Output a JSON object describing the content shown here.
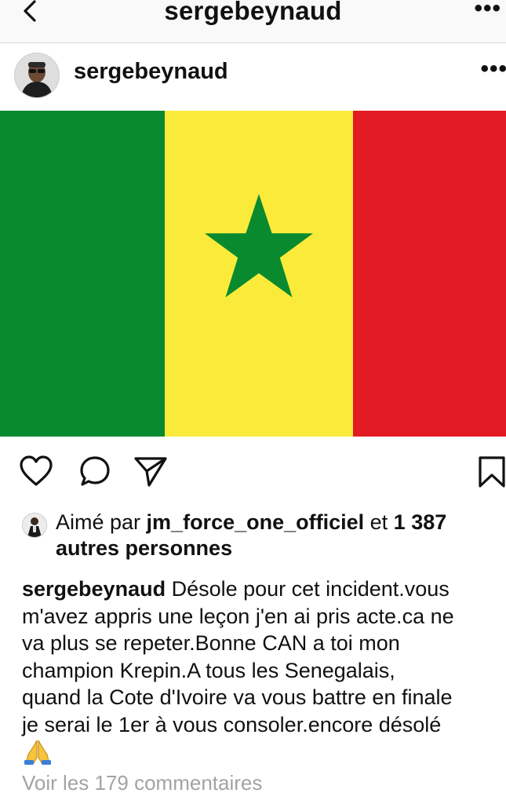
{
  "topbar": {
    "title": "sergebeynaud",
    "more_label": "•••"
  },
  "post": {
    "username": "sergebeynaud",
    "more_label": "•••",
    "flag_colors": {
      "green": "#0a8a2f",
      "yellow": "#faeb3a",
      "red": "#e21a23"
    }
  },
  "likes": {
    "prefix": "Aimé par ",
    "user": "jm_force_one_officiel",
    "connector": " et ",
    "count": "1 387",
    "suffix": "autres personnes"
  },
  "caption": {
    "username": "sergebeynaud",
    "lines": [
      " Désole pour cet incident.vous",
      "m'avez appris une leçon j'en ai pris acte.ca ne",
      "va plus se repeter.Bonne CAN a toi mon",
      "champion Krepin.A tous les Senegalais,",
      "quand la Cote d'Ivoire va vous battre en finale",
      "je serai le 1er à vous consoler.encore désolé"
    ]
  },
  "comments": {
    "label": "Voir les 179 commentaires"
  }
}
